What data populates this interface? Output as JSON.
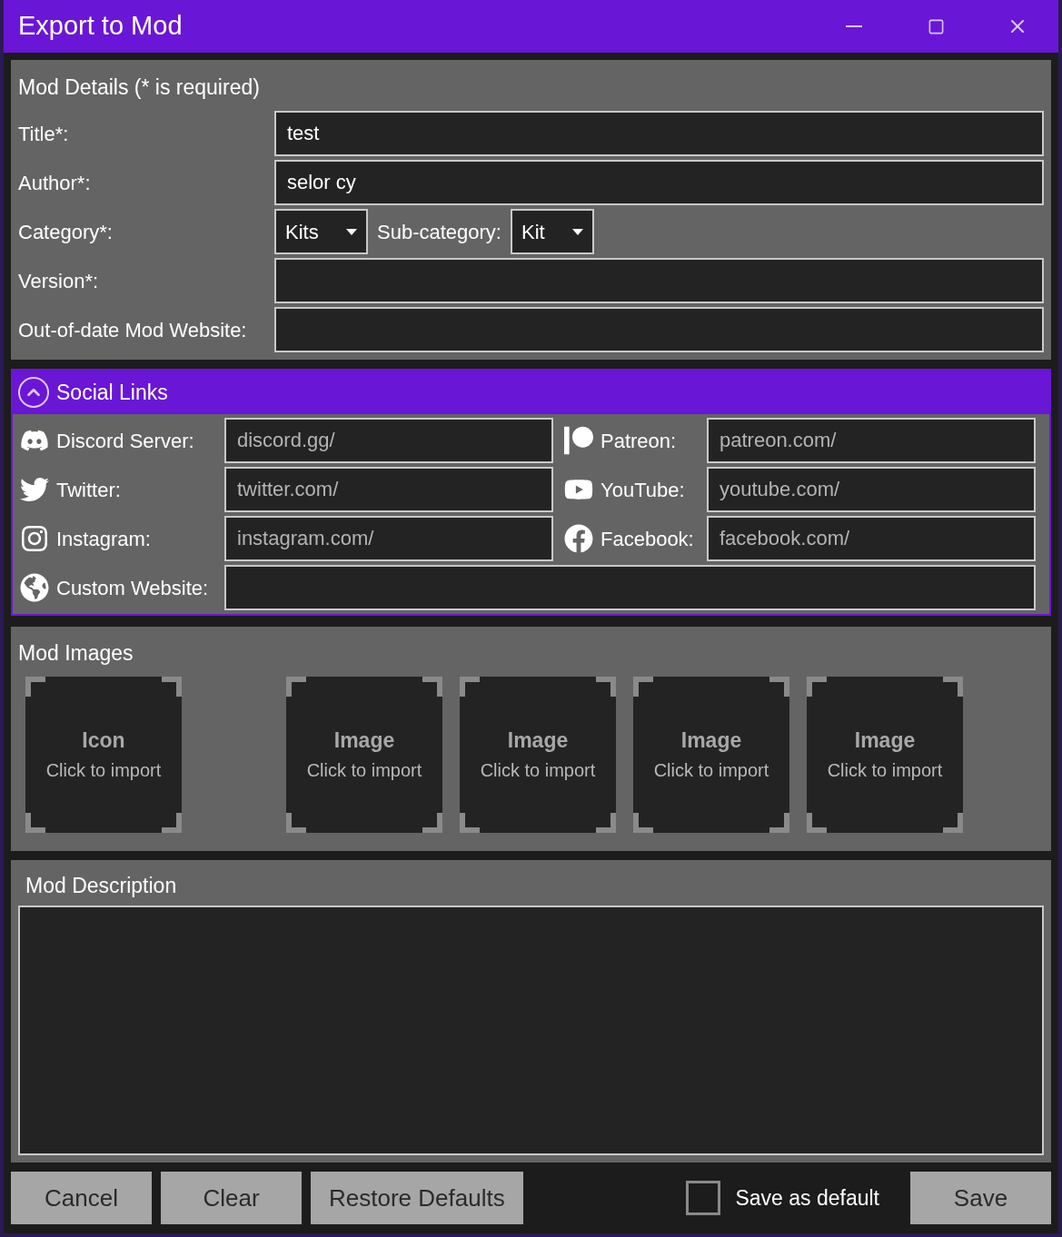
{
  "window": {
    "title": "Export to Mod"
  },
  "details": {
    "heading": "Mod Details (* is required)",
    "fields": [
      {
        "kind": "text",
        "label": "Title*:",
        "value": "test"
      },
      {
        "kind": "text",
        "label": "Author*:",
        "value": "selor cy"
      },
      {
        "kind": "dropdowns",
        "label": "Category*:",
        "value": "Kits",
        "sub_label": "Sub-category:",
        "sub_value": "Kit"
      },
      {
        "kind": "text",
        "label": "Version*:"
      },
      {
        "kind": "text",
        "label": "Out-of-date Mod Website:"
      }
    ]
  },
  "social": {
    "heading": "Social Links",
    "expanded": true,
    "links": [
      {
        "kind": "discord",
        "label": "Discord Server:",
        "placeholder": "discord.gg/",
        "wide": false
      },
      {
        "kind": "patreon",
        "label": "Patreon:",
        "placeholder": "patreon.com/",
        "wide": false
      },
      {
        "kind": "twitter",
        "label": "Twitter:",
        "placeholder": "twitter.com/",
        "wide": false
      },
      {
        "kind": "youtube",
        "label": "YouTube:",
        "placeholder": "youtube.com/",
        "wide": false
      },
      {
        "kind": "instagram",
        "label": "Instagram:",
        "placeholder": "instagram.com/",
        "wide": false
      },
      {
        "kind": "facebook",
        "label": "Facebook:",
        "placeholder": "facebook.com/",
        "wide": false
      },
      {
        "kind": "globe",
        "label": "Custom Website:",
        "wide": true
      }
    ]
  },
  "images": {
    "heading": "Mod Images",
    "slots": [
      {
        "title": "Icon",
        "hint": "Click to import"
      },
      {
        "title": "Image",
        "hint": "Click to import"
      },
      {
        "title": "Image",
        "hint": "Click to import"
      },
      {
        "title": "Image",
        "hint": "Click to import"
      },
      {
        "title": "Image",
        "hint": "Click to import"
      }
    ]
  },
  "description": {
    "heading": "Mod Description"
  },
  "footer": {
    "buttons": [
      "Cancel",
      "Clear",
      "Restore Defaults"
    ],
    "save_default": {
      "label": "Save as default",
      "checked": false
    },
    "save": "Save"
  }
}
